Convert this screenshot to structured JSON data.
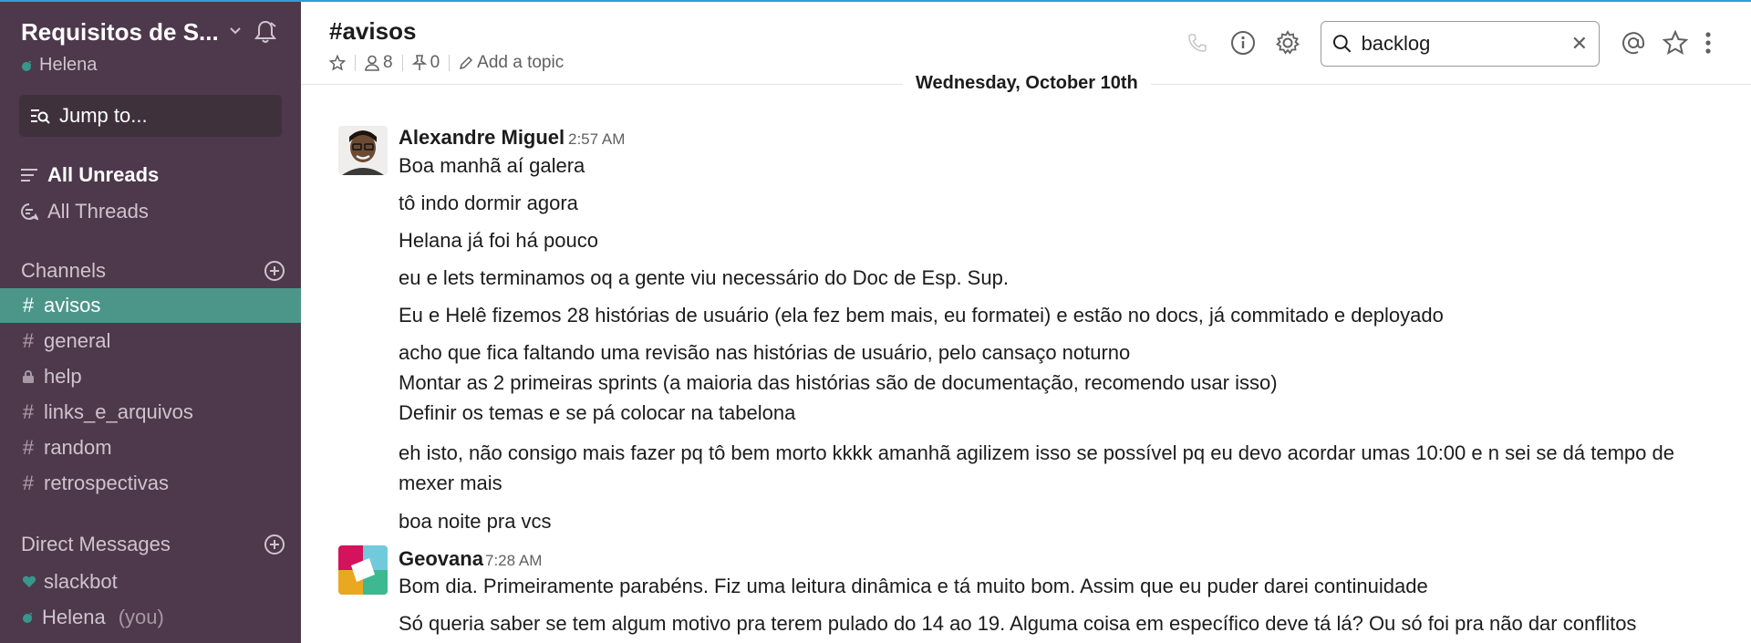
{
  "sidebar": {
    "team_name": "Requisitos de S...",
    "user": "Helena",
    "jump_label": "Jump to...",
    "nav": [
      {
        "label": "All Unreads"
      },
      {
        "label": "All Threads"
      }
    ],
    "channels_title": "Channels",
    "channels": [
      {
        "label": "avisos",
        "icon": "hash"
      },
      {
        "label": "general",
        "icon": "hash"
      },
      {
        "label": "help",
        "icon": "lock"
      },
      {
        "label": "links_e_arquivos",
        "icon": "hash"
      },
      {
        "label": "random",
        "icon": "hash"
      },
      {
        "label": "retrospectivas",
        "icon": "hash"
      }
    ],
    "dm_title": "Direct Messages",
    "dms": [
      {
        "label": "slackbot",
        "suffix": ""
      },
      {
        "label": "Helena",
        "suffix": "(you)"
      }
    ]
  },
  "header": {
    "channel_name": "#avisos",
    "member_count": "8",
    "pinned_count": "0",
    "topic_placeholder": "Add a topic",
    "search_value": "backlog"
  },
  "date_divider": "Wednesday, October 10th",
  "messages": [
    {
      "author": "Alexandre Miguel",
      "time": "2:57 AM",
      "lines": [
        "Boa manhã aí galera",
        "tô indo dormir agora",
        "Helana já foi há pouco",
        "eu e lets terminamos oq a gente viu necessário do Doc de Esp. Sup.",
        "Eu e Helê fizemos 28 histórias de usuário (ela fez bem mais, eu formatei) e estão no docs, já commitado e deployado",
        "acho que fica faltando uma revisão nas histórias de usuário, pelo cansaço noturno",
        "Montar as 2 primeiras sprints (a maioria das histórias são de documentação, recomendo usar isso)",
        "Definir os temas e se pá colocar na tabelona",
        "eh isto, não consigo mais fazer pq tô bem morto kkkk amanhã agilizem isso se possível pq eu devo acordar umas 10:00 e n sei se dá tempo de mexer mais",
        "boa noite pra vcs"
      ]
    },
    {
      "author": "Geovana",
      "time": "7:28 AM",
      "lines": [
        "Bom dia. Primeiramente parabéns. Fiz uma leitura dinâmica e tá muito bom. Assim que eu puder darei continuidade",
        "Só queria saber se tem algum motivo pra terem pulado do 14 ao 19. Alguma coisa em específico deve tá lá? Ou só foi pra não dar conflitos"
      ]
    }
  ],
  "colors": {
    "sidebar_bg": "#4d394b",
    "active_channel": "#4c9689",
    "presence": "#38978d"
  }
}
